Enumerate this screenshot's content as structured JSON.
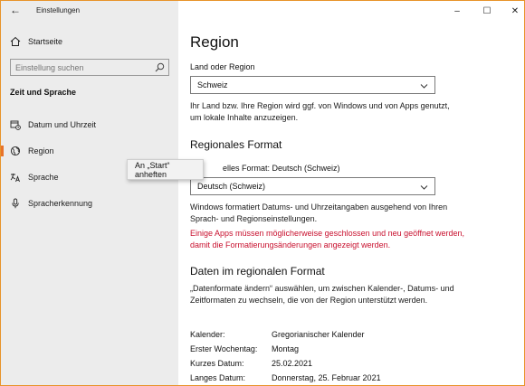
{
  "window": {
    "title": "Einstellungen",
    "back": "←",
    "minimize": "–",
    "maximize": "☐",
    "close": "✕"
  },
  "sidebar": {
    "home_label": "Startseite",
    "search_placeholder": "Einstellung suchen",
    "section_title": "Zeit und Sprache",
    "items": [
      {
        "label": "Datum und Uhrzeit",
        "icon": "calendar-clock-icon"
      },
      {
        "label": "Region",
        "icon": "globe-icon",
        "selected": true
      },
      {
        "label": "Sprache",
        "icon": "language-icon"
      },
      {
        "label": "Spracherkennung",
        "icon": "microphone-icon"
      }
    ]
  },
  "context_menu": {
    "item": "An „Start“ anheften"
  },
  "main": {
    "title": "Region",
    "country_label": "Land oder Region",
    "country_value": "Schweiz",
    "country_desc": "Ihr Land bzw. Ihre Region wird ggf. von Windows und von Apps genutzt, um lokale Inhalte anzuzeigen.",
    "format_heading": "Regionales Format",
    "format_label": "Aktuelles Format: Deutsch (Schweiz)",
    "format_label_visible": "elles Format: Deutsch (Schweiz)",
    "format_value": "Deutsch (Schweiz)",
    "format_desc": "Windows formatiert Datums- und Uhrzeitangaben ausgehend von Ihren Sprach- und Regionseinstellungen.",
    "warning": "Einige Apps müssen möglicherweise geschlossen und neu geöffnet werden, damit die Formatierungsänderungen angezeigt werden.",
    "data_heading": "Daten im regionalen Format",
    "data_desc": "„Datenformate ändern“ auswählen, um zwischen Kalender-, Datums- und Zeitformaten zu wechseln, die von der Region unterstützt werden.",
    "kv": [
      {
        "label": "Kalender:",
        "value": "Gregorianischer Kalender"
      },
      {
        "label": "Erster Wochentag:",
        "value": "Montag"
      },
      {
        "label": "Kurzes Datum:",
        "value": "25.02.2021"
      },
      {
        "label": "Langes Datum:",
        "value": "Donnerstag, 25. Februar 2021"
      }
    ]
  },
  "colors": {
    "accent": "#e8732a",
    "warning": "#c8102e",
    "sidebar_bg": "#ececec"
  }
}
